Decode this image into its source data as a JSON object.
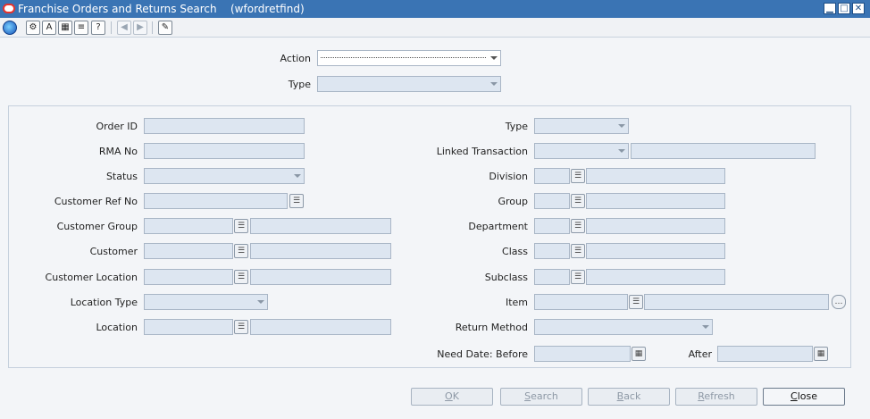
{
  "window": {
    "title": "Franchise Orders and Returns Search",
    "form_name": "(wfordretfind)",
    "minimize": "▁",
    "maximize": "□",
    "close": "✕"
  },
  "toolbar": {
    "icons": [
      "globe-icon",
      "help-icon",
      "spell-check-icon",
      "calculator-icon",
      "notes-icon",
      "help-question-icon",
      "previous-record-icon",
      "next-record-icon",
      "edit-icon"
    ],
    "glyphs": [
      "",
      "⚙",
      "A",
      "▦",
      "≡",
      "?",
      "◀",
      "▶",
      "✎"
    ]
  },
  "header": {
    "action_label": "Action",
    "action_value": "",
    "type_label": "Type",
    "type_value": ""
  },
  "left": {
    "order_id_label": "Order ID",
    "rma_no_label": "RMA No",
    "status_label": "Status",
    "customer_ref_no_label": "Customer Ref No",
    "customer_group_label": "Customer Group",
    "customer_label": "Customer",
    "customer_location_label": "Customer Location",
    "location_type_label": "Location Type",
    "location_label": "Location"
  },
  "right": {
    "type_label": "Type",
    "linked_transaction_label": "Linked Transaction",
    "division_label": "Division",
    "group_label": "Group",
    "department_label": "Department",
    "class_label": "Class",
    "subclass_label": "Subclass",
    "item_label": "Item",
    "return_method_label": "Return Method",
    "need_date_before_label": "Need Date: Before",
    "after_label": "After"
  },
  "buttons": {
    "ok_prefix": "",
    "ok_u": "O",
    "ok_rest": "K",
    "search_u": "S",
    "search_rest": "earch",
    "back_u": "B",
    "back_rest": "ack",
    "refresh_u": "R",
    "refresh_rest": "efresh",
    "close_u": "C",
    "close_rest": "lose"
  },
  "colors": {
    "titlebar": "#3a74b4",
    "field_disabled": "#dde6f1"
  }
}
